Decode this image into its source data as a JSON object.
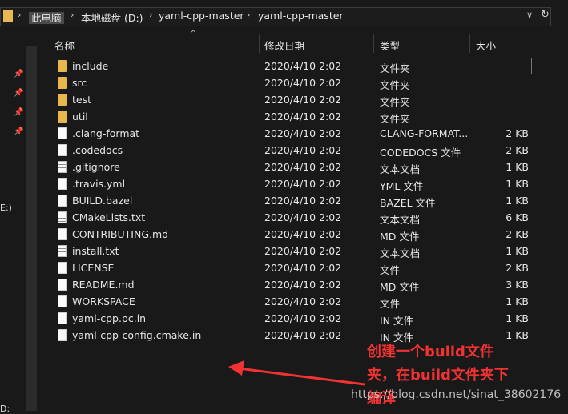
{
  "breadcrumbs": [
    "此电脑",
    "本地磁盘 (D:)",
    "yaml-cpp-master",
    "yaml-cpp-master"
  ],
  "nav": {
    "drive_label": "E:)",
    "drive_label2": "D:"
  },
  "columns": {
    "name": "名称",
    "date": "修改日期",
    "type": "类型",
    "size": "大小"
  },
  "files": [
    {
      "name": "include",
      "date": "2020/4/10 2:02",
      "type": "文件夹",
      "size": "",
      "icon": "folder",
      "selected": true
    },
    {
      "name": "src",
      "date": "2020/4/10 2:02",
      "type": "文件夹",
      "size": "",
      "icon": "folder"
    },
    {
      "name": "test",
      "date": "2020/4/10 2:02",
      "type": "文件夹",
      "size": "",
      "icon": "folder"
    },
    {
      "name": "util",
      "date": "2020/4/10 2:02",
      "type": "文件夹",
      "size": "",
      "icon": "folder"
    },
    {
      "name": ".clang-format",
      "date": "2020/4/10 2:02",
      "type": "CLANG-FORMAT...",
      "size": "2 KB",
      "icon": "file"
    },
    {
      "name": ".codedocs",
      "date": "2020/4/10 2:02",
      "type": "CODEDOCS 文件",
      "size": "2 KB",
      "icon": "file"
    },
    {
      "name": ".gitignore",
      "date": "2020/4/10 2:02",
      "type": "文本文档",
      "size": "1 KB",
      "icon": "text"
    },
    {
      "name": ".travis.yml",
      "date": "2020/4/10 2:02",
      "type": "YML 文件",
      "size": "1 KB",
      "icon": "file"
    },
    {
      "name": "BUILD.bazel",
      "date": "2020/4/10 2:02",
      "type": "BAZEL 文件",
      "size": "1 KB",
      "icon": "file"
    },
    {
      "name": "CMakeLists.txt",
      "date": "2020/4/10 2:02",
      "type": "文本文档",
      "size": "6 KB",
      "icon": "text"
    },
    {
      "name": "CONTRIBUTING.md",
      "date": "2020/4/10 2:02",
      "type": "MD 文件",
      "size": "2 KB",
      "icon": "file"
    },
    {
      "name": "install.txt",
      "date": "2020/4/10 2:02",
      "type": "文本文档",
      "size": "1 KB",
      "icon": "text"
    },
    {
      "name": "LICENSE",
      "date": "2020/4/10 2:02",
      "type": "文件",
      "size": "2 KB",
      "icon": "file"
    },
    {
      "name": "README.md",
      "date": "2020/4/10 2:02",
      "type": "MD 文件",
      "size": "3 KB",
      "icon": "file"
    },
    {
      "name": "WORKSPACE",
      "date": "2020/4/10 2:02",
      "type": "文件",
      "size": "1 KB",
      "icon": "file"
    },
    {
      "name": "yaml-cpp.pc.in",
      "date": "2020/4/10 2:02",
      "type": "IN 文件",
      "size": "1 KB",
      "icon": "file"
    },
    {
      "name": "yaml-cpp-config.cmake.in",
      "date": "2020/4/10 2:02",
      "type": "IN 文件",
      "size": "1 KB",
      "icon": "file"
    }
  ],
  "annotation": {
    "line1": "创建一个build文件",
    "line2": "夹，在build文件夹下",
    "line3": "编译",
    "color": "#f03232"
  },
  "watermark": "https://blog.csdn.net/sinat_38602176"
}
